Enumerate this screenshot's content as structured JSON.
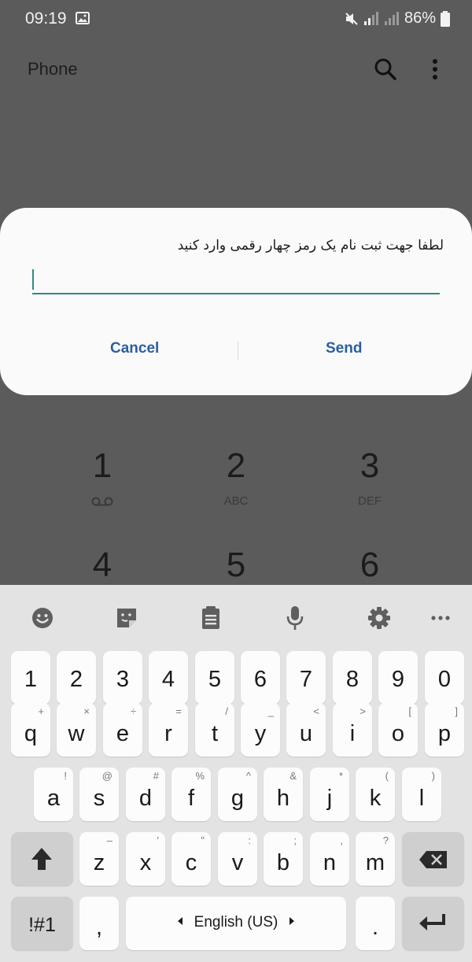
{
  "status": {
    "time": "09:19",
    "battery": "86%"
  },
  "header": {
    "title": "Phone",
    "search_icon": "search-icon",
    "more_icon": "more-vertical-icon"
  },
  "dialpad": [
    {
      "digit": "1",
      "sub": ""
    },
    {
      "digit": "2",
      "sub": "ABC"
    },
    {
      "digit": "3",
      "sub": "DEF"
    },
    {
      "digit": "4",
      "sub": ""
    },
    {
      "digit": "5",
      "sub": ""
    },
    {
      "digit": "6",
      "sub": ""
    }
  ],
  "dialog": {
    "message": "لطفا جهت ثبت نام یک رمز چهار رقمی وارد کنید",
    "input_value": "",
    "cancel_label": "Cancel",
    "send_label": "Send"
  },
  "keyboard": {
    "toolbar": [
      "emoji-icon",
      "sticker-icon",
      "clipboard-icon",
      "microphone-icon",
      "settings-icon",
      "more-horizontal-icon"
    ],
    "numbers": [
      "1",
      "2",
      "3",
      "4",
      "5",
      "6",
      "7",
      "8",
      "9",
      "0"
    ],
    "row1": [
      [
        "q",
        "+"
      ],
      [
        "w",
        "×"
      ],
      [
        "e",
        "÷"
      ],
      [
        "r",
        "="
      ],
      [
        "t",
        "/"
      ],
      [
        "y",
        "_"
      ],
      [
        "u",
        "<"
      ],
      [
        "i",
        ">"
      ],
      [
        "o",
        "["
      ],
      [
        "p",
        "]"
      ]
    ],
    "row2": [
      [
        "a",
        "!"
      ],
      [
        "s",
        "@"
      ],
      [
        "d",
        "#"
      ],
      [
        "f",
        "%"
      ],
      [
        "g",
        "^"
      ],
      [
        "h",
        "&"
      ],
      [
        "j",
        "*"
      ],
      [
        "k",
        "("
      ],
      [
        "l",
        ")"
      ]
    ],
    "row3": [
      [
        "z",
        "–"
      ],
      [
        "x",
        "'"
      ],
      [
        "c",
        "\""
      ],
      [
        "v",
        ":"
      ],
      [
        "b",
        ";"
      ],
      [
        "n",
        ","
      ],
      [
        "m",
        "?"
      ]
    ],
    "symbols_label": "!#1",
    "comma_label": ",",
    "space_label": "English (US)",
    "period_label": "."
  },
  "colors": {
    "accent": "#2a8c84",
    "button_text": "#2b5fa0",
    "scrim": "#5b5b5b",
    "dialog_bg": "#fafafa",
    "keyboard_bg": "#e3e3e3"
  }
}
